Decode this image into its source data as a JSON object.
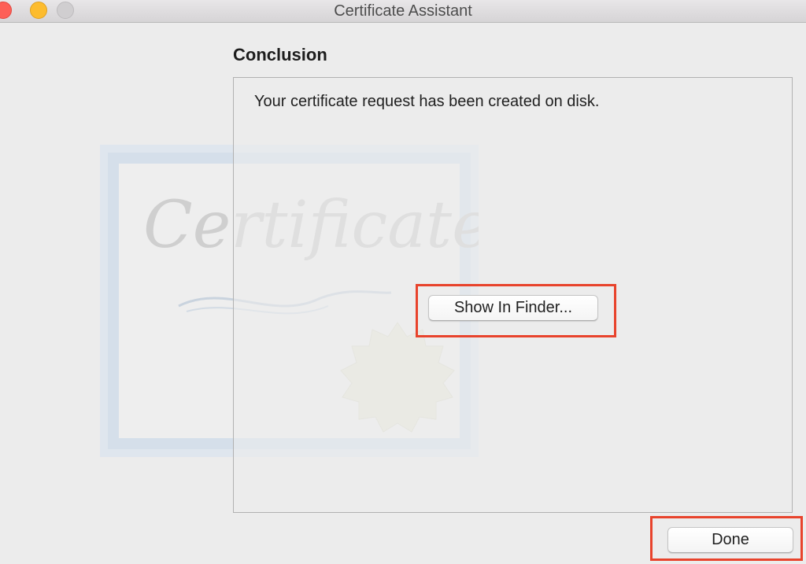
{
  "window": {
    "title": "Certificate Assistant",
    "controls": {
      "close": "close-icon",
      "minimize": "minimize-icon",
      "zoom": "zoom-icon"
    }
  },
  "main": {
    "heading": "Conclusion",
    "message": "Your certificate request has been created on disk.",
    "show_in_finder_label": "Show In Finder...",
    "artwork_text": "Certificate"
  },
  "footer": {
    "done_label": "Done"
  },
  "colors": {
    "highlight": "#e8432c",
    "close": "#fd5f57",
    "minimize": "#fdbc2e",
    "zoom_disabled": "#d0ced0"
  }
}
